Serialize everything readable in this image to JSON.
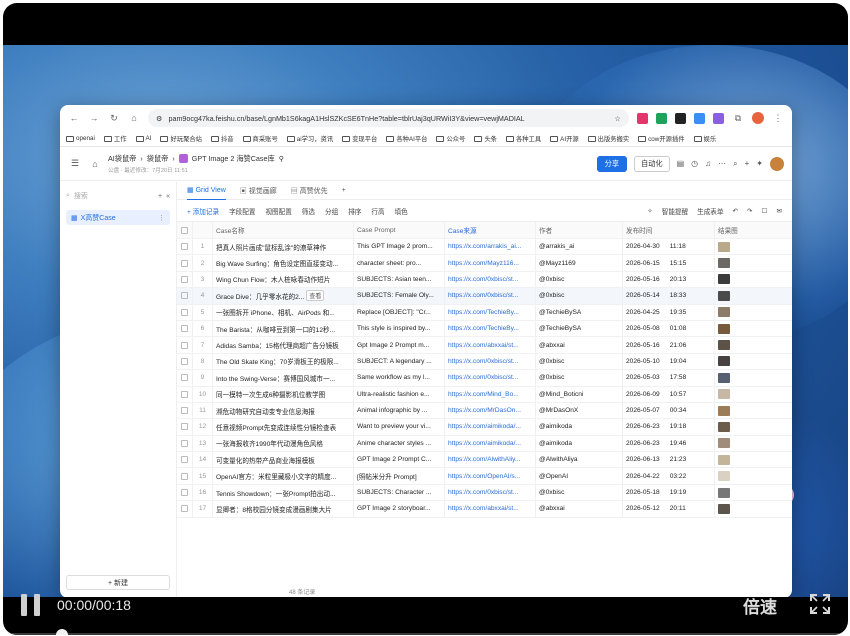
{
  "player": {
    "time": "00:00/00:18",
    "speed_label": "倍速",
    "progress": 0.0
  },
  "browser": {
    "url": "pam9ocg47ka.feishu.cn/base/LgnMb1S6kagA1HslSZKcSE6TnHe?table=tblrUaj3qURWiI3Y&view=vewjMADIAL",
    "bookmarks": [
      "openai",
      "工作",
      "AI",
      "好玩聚合站",
      "抖音",
      "商采账号",
      "ai学习，资讯",
      "变现平台",
      "各种AI平台",
      "公众号",
      "头条",
      "各种工具",
      "AI开源",
      "出版务搬实",
      "cow开源插件",
      "娱乐"
    ]
  },
  "app": {
    "breadcrumb": [
      "AI袋鼠帝",
      "袋鼠帝"
    ],
    "base_title": "GPT Image 2 海赞Case库",
    "subtitle": "公盘 · 最近修改：7月20日 11:51",
    "share_label": "分享",
    "automation_label": "自动化",
    "search_placeholder": "搜索",
    "table_name": "X高赞Case",
    "new_label": "+ 新建",
    "tabs": [
      "Grid View",
      "视觉画廊",
      "高赞优先"
    ],
    "toolbar": [
      "+ 添加记录",
      "字段配置",
      "视图配置",
      "筛选",
      "分组",
      "排序",
      "行高",
      "填色"
    ],
    "toolbar_right": [
      "智能提醒",
      "生成表单"
    ],
    "columns": [
      "Case名称",
      "Case Prompt",
      "Case来源",
      "作者",
      "发布时间",
      "结果图"
    ],
    "hover_action": "查看",
    "record_count": "48 条记录",
    "rows": [
      {
        "n": "1",
        "name": "把真人照片画成\"鼠标乱涂\"的潦草神作",
        "prompt": "This GPT Image 2 prom...",
        "src": "https://x.com/arrakis_ai...",
        "author": "@arrakis_ai",
        "date": "2026-04-30",
        "time": "11:18",
        "thumb": "#b9a889"
      },
      {
        "n": "2",
        "name": "Big Wave Surfing：角色设定图直接变动...",
        "prompt": "character sheet: pro...",
        "src": "https://x.com/Mayz116...",
        "author": "@Mayz1169",
        "date": "2026-06-15",
        "time": "15:15",
        "thumb": "#6d6a66"
      },
      {
        "n": "3",
        "name": "Wing Chun Flow：木人桩咏春动作短片",
        "prompt": "SUBJECTS: Asian teen...",
        "src": "https://x.com/0xbisc/st...",
        "author": "@0xbisc",
        "date": "2026-05-16",
        "time": "20:13",
        "thumb": "#3b3b3b"
      },
      {
        "n": "4",
        "name": "Grace Dive：几乎零水花的2...",
        "prompt": "SUBJECTS: Female Oly...",
        "src": "https://x.com/0xbisc/st...",
        "author": "@0xbisc",
        "date": "2026-05-14",
        "time": "18:33",
        "thumb": "#4a4a4a"
      },
      {
        "n": "5",
        "name": "一张图拆开 iPhone、相机、AirPods 和...",
        "prompt": "Replace [OBJECT]: \"Cr...",
        "src": "https://x.com/TechieBy...",
        "author": "@TechieBySA",
        "date": "2026-04-25",
        "time": "19:35",
        "thumb": "#8d7c68"
      },
      {
        "n": "6",
        "name": "The Barista：从咖啡豆到第一口的12秒...",
        "prompt": "This style is inspired by...",
        "src": "https://x.com/TechieBy...",
        "author": "@TechieBySA",
        "date": "2026-05-08",
        "time": "01:08",
        "thumb": "#7a5a3c"
      },
      {
        "n": "7",
        "name": "Adidas Samba：15格代理商超广告分镜板",
        "prompt": "Gpt Image 2 Prompt m...",
        "src": "https://x.com/abxxai/st...",
        "author": "@abxxai",
        "date": "2026-05-16",
        "time": "21:06",
        "thumb": "#5c5248"
      },
      {
        "n": "8",
        "name": "The Old Skate King：70岁滑板王的极限...",
        "prompt": "SUBJECT: A legendary ...",
        "src": "https://x.com/0xbisc/st...",
        "author": "@0xbisc",
        "date": "2026-05-10",
        "time": "19:04",
        "thumb": "#484340"
      },
      {
        "n": "9",
        "name": "Into the Swing-Verse：赛博国风城市一...",
        "prompt": "Same workflow as my l...",
        "src": "https://x.com/0xbisc/st...",
        "author": "@0xbisc",
        "date": "2026-05-03",
        "time": "17:58",
        "thumb": "#556070"
      },
      {
        "n": "10",
        "name": "同一模特一次生成6种摄影机位教学图",
        "prompt": "Ultra-realistic fashion e...",
        "src": "https://x.com/Mind_Bo...",
        "author": "@Mind_Boticni",
        "date": "2026-06-09",
        "time": "10:57",
        "thumb": "#c7b7a5"
      },
      {
        "n": "11",
        "name": "濒危动物研究自动变专业信息海报",
        "prompt": "Animal infographic by ...",
        "src": "https://x.com/MrDasOn...",
        "author": "@MrDasOnX",
        "date": "2026-05-07",
        "time": "00:34",
        "thumb": "#9c7b58"
      },
      {
        "n": "12",
        "name": "任意视频Prompt先变成连续性分镜检查表",
        "prompt": "Want to preview your vi...",
        "src": "https://x.com/aimikoda/...",
        "author": "@aimikoda",
        "date": "2026-06-23",
        "time": "19:18",
        "thumb": "#6b5c4c"
      },
      {
        "n": "13",
        "name": "一张海报收齐1990年代动漫角色风格",
        "prompt": "Anime character styles ...",
        "src": "https://x.com/aimikoda/...",
        "author": "@aimikoda",
        "date": "2026-06-23",
        "time": "19:46",
        "thumb": "#a08c7a"
      },
      {
        "n": "14",
        "name": "可变量化的热带产品商业海报模板",
        "prompt": "GPT Image 2 Prompt C...",
        "src": "https://x.com/AlwithAliy...",
        "author": "@AlwithAliya",
        "date": "2026-06-13",
        "time": "21:23",
        "thumb": "#c2b59a"
      },
      {
        "n": "15",
        "name": "OpenAI官方：米粒里藏极小文字的精度...",
        "prompt": "[照帖米分升 Prompt]",
        "src": "https://x.com/OpenAI/s...",
        "author": "@OpenAI",
        "date": "2026-04-22",
        "time": "03:22",
        "thumb": "#d9d2c2"
      },
      {
        "n": "16",
        "name": "Tennis Showdown：一张Prompt拍出动...",
        "prompt": "SUBJECTS: Character ...",
        "src": "https://x.com/0xbisc/st...",
        "author": "@0xbisc",
        "date": "2026-05-18",
        "time": "19:19",
        "thumb": "#777777"
      },
      {
        "n": "17",
        "name": "显卿者：8格校园分镜变成漫画剧集大片",
        "prompt": "GPT Image 2 storyboar...",
        "src": "https://x.com/abxxai/st...",
        "author": "@abxxai",
        "date": "2026-05-12",
        "time": "20:11",
        "thumb": "#5d564e"
      }
    ]
  }
}
